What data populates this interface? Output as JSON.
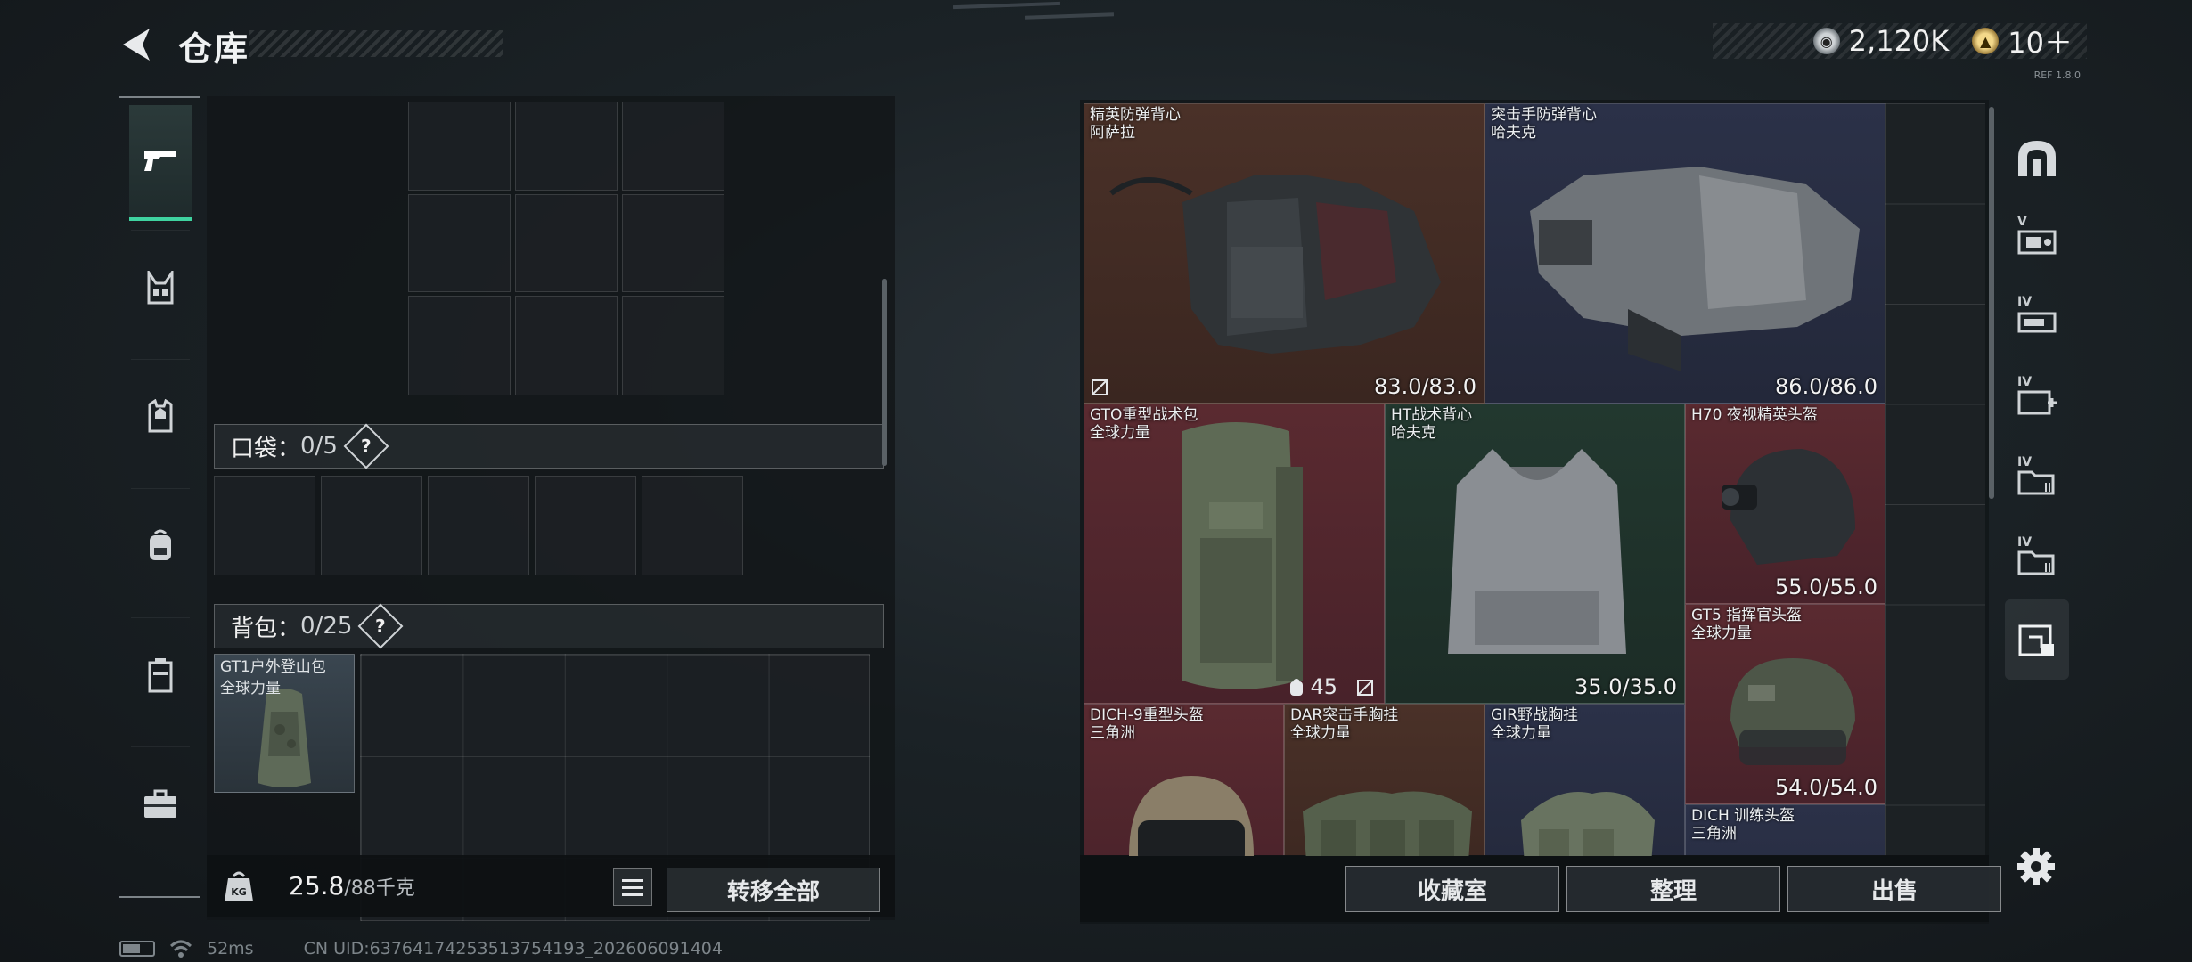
{
  "header": {
    "title": "仓库"
  },
  "currency": {
    "silver_value": "2,120K",
    "gold_value": "10＋",
    "version_tag": "REF 1.8.0"
  },
  "left_tabs": [
    {
      "icon": "pistol-icon",
      "active": true
    },
    {
      "icon": "chest-rig-icon",
      "active": false
    },
    {
      "icon": "armor-vest-icon",
      "active": false
    },
    {
      "icon": "backpack-icon",
      "active": false
    },
    {
      "icon": "case-icon",
      "active": false
    },
    {
      "icon": "toolbox-icon",
      "active": false
    }
  ],
  "pockets": {
    "label": "口袋：",
    "count": "0/5",
    "help": "?"
  },
  "backpack": {
    "label": "背包：",
    "count": "0/25",
    "help": "?",
    "item_name": "GT1户外登山包",
    "item_brand": "全球力量"
  },
  "footer_left": {
    "weight_value": "25.8",
    "weight_capacity": "/88千克",
    "weight_icon_label": "KG",
    "transfer_all": "转移全部"
  },
  "stash_items": [
    {
      "name": "精英防弹背心",
      "brand": "阿萨拉",
      "durability": "83.0/83.0",
      "tint": "brown"
    },
    {
      "name": "突击手防弹背心",
      "brand": "哈夫克",
      "durability": "86.0/86.0",
      "tint": "navy"
    },
    {
      "name": "GTO重型战术包",
      "brand": "全球力量",
      "count": "45",
      "tint": "red"
    },
    {
      "name": "HT战术背心",
      "brand": "哈夫克",
      "durability": "35.0/35.0",
      "tint": "green"
    },
    {
      "name": "H70 夜视精英头盔",
      "brand": "",
      "durability": "55.0/55.0",
      "tint": "red"
    },
    {
      "name": "GT5 指挥官头盔",
      "brand": "全球力量",
      "durability": "54.0/54.0",
      "tint": "red"
    },
    {
      "name": "DICH-9重型头盔",
      "brand": "三角洲",
      "tint": "red"
    },
    {
      "name": "DAR突击手胸挂",
      "brand": "全球力量",
      "tint": "brown"
    },
    {
      "name": "GIR野战胸挂",
      "brand": "全球力量",
      "tint": "navy"
    },
    {
      "name": "DICH 训练头盔",
      "brand": "三角洲",
      "tint": "navy"
    }
  ],
  "right_tabs": [
    {
      "icon": "helmet-category-icon",
      "level": ""
    },
    {
      "icon": "weapon-level-v-icon",
      "level": "V"
    },
    {
      "icon": "weapon-level-iv-icon",
      "level": "IV"
    },
    {
      "icon": "medkit-level-iv-icon",
      "level": "IV"
    },
    {
      "icon": "folder-level-iv-icon",
      "level": "IV"
    },
    {
      "icon": "folder-level-iv-b-icon",
      "level": "IV"
    },
    {
      "icon": "grid-select-icon",
      "level": ""
    }
  ],
  "footer_right": {
    "collection_room": "收藏室",
    "sort": "整理",
    "sell": "出售"
  },
  "status": {
    "ping": "52ms",
    "uid": "CN UID:637641742535137541​93_202606091404"
  },
  "colors": {
    "accent_green": "#3fd3a0",
    "tint_brown": "#4a3128",
    "tint_red": "#5a2a30",
    "tint_navy": "#2b3148",
    "tint_green": "#22382f"
  }
}
